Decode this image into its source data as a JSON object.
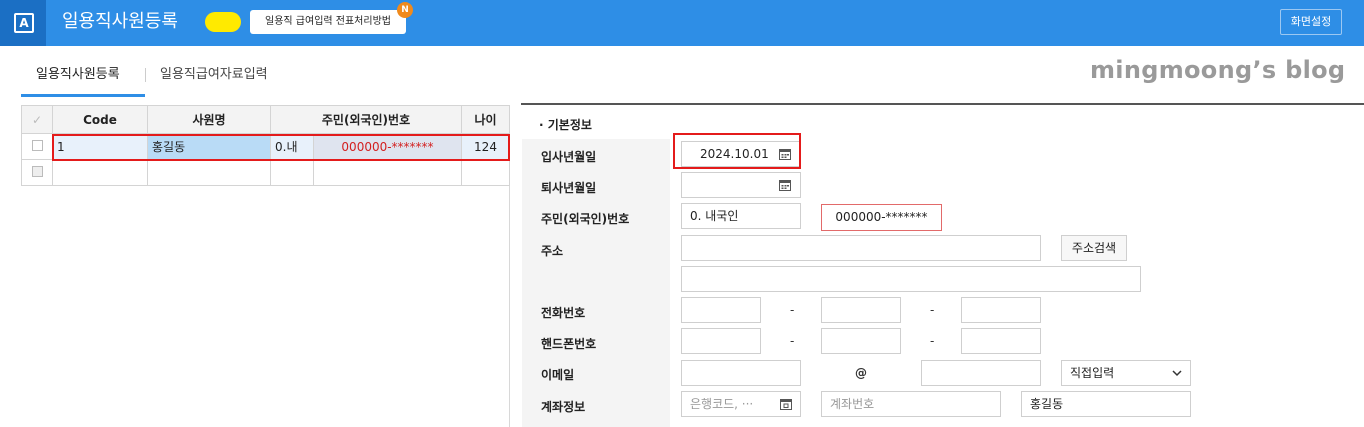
{
  "app": {
    "logo_letter": "A",
    "title": "일용직사원등록",
    "tip": "일용직 급여입력 전표처리방법",
    "tip_badge": "N",
    "screen_settings": "화면설정"
  },
  "tabs": [
    {
      "label": "일용직사원등록"
    },
    {
      "label": "일용직급여자료입력"
    }
  ],
  "watermark": "mingmoong’s blog",
  "grid": {
    "headers": [
      "Code",
      "사원명",
      "주민(외국인)번호",
      "나이"
    ],
    "rows": [
      {
        "code": "1",
        "name": "홍길동",
        "type": "0.내",
        "rrn": "000000-*******",
        "age": "124"
      }
    ]
  },
  "form": {
    "section_title": "· 기본정보",
    "hire_date_label": "입사년월일",
    "hire_date": "2024.10.01",
    "leave_date_label": "퇴사년월일",
    "rrn_label": "주민(외국인)번호",
    "nationality": "0. 내국인",
    "rrn": "000000-*******",
    "address_label": "주소",
    "address_search": "주소검색",
    "phone_label": "전화번호",
    "mobile_label": "핸드폰번호",
    "dash": "-",
    "email_label": "이메일",
    "at": "@",
    "email_domain": "직접입력",
    "account_label": "계좌정보",
    "bank_code_placeholder": "은행코드, ···",
    "account_no_placeholder": "계좌번호",
    "account_holder": "홍길동"
  }
}
